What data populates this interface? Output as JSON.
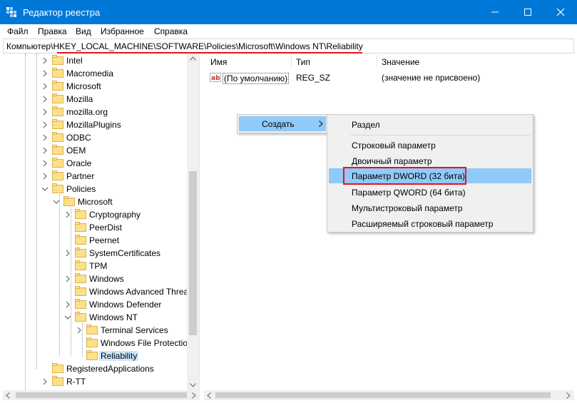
{
  "window": {
    "title": "Редактор реестра",
    "icon": "registry-editor-icon",
    "accent_color": "#0078d7"
  },
  "menu": [
    "Файл",
    "Правка",
    "Вид",
    "Избранное",
    "Справка"
  ],
  "address": {
    "path": "Компьютер\\HKEY_LOCAL_MACHINE\\SOFTWARE\\Policies\\Microsoft\\Windows NT\\Reliability",
    "underline_color": "#e81123"
  },
  "tree": [
    {
      "label": "Intel"
    },
    {
      "label": "Macromedia"
    },
    {
      "label": "Microsoft"
    },
    {
      "label": "Mozilla"
    },
    {
      "label": "mozilla.org"
    },
    {
      "label": "MozillaPlugins"
    },
    {
      "label": "ODBC"
    },
    {
      "label": "OEM"
    },
    {
      "label": "Oracle"
    },
    {
      "label": "Partner"
    },
    {
      "label": "Policies"
    },
    {
      "label": "Microsoft"
    },
    {
      "label": "Cryptography"
    },
    {
      "label": "PeerDist"
    },
    {
      "label": "Peernet"
    },
    {
      "label": "SystemCertificates"
    },
    {
      "label": "TPM"
    },
    {
      "label": "Windows"
    },
    {
      "label": "Windows Advanced Threat"
    },
    {
      "label": "Windows Defender"
    },
    {
      "label": "Windows NT"
    },
    {
      "label": "Terminal Services"
    },
    {
      "label": "Windows File Protection"
    },
    {
      "label": "Reliability"
    },
    {
      "label": "RegisteredApplications"
    },
    {
      "label": "R-TT"
    }
  ],
  "columns": {
    "name": "Имя",
    "type": "Тип",
    "value": "Значение"
  },
  "values": [
    {
      "name": "(По умолчанию)",
      "type": "REG_SZ",
      "data": "(значение не присвоено)",
      "icon": "string-value-icon"
    }
  ],
  "context_menu": {
    "create": "Создать",
    "submenu": [
      "Раздел",
      "Строковый параметр",
      "Двоичный параметр",
      "Параметр DWORD (32 бита)",
      "Параметр QWORD (64 бита)",
      "Мультистроковый параметр",
      "Расширяемый строковый параметр"
    ],
    "highlight_color": "#91c9f7",
    "marker_color": "#e81123"
  }
}
